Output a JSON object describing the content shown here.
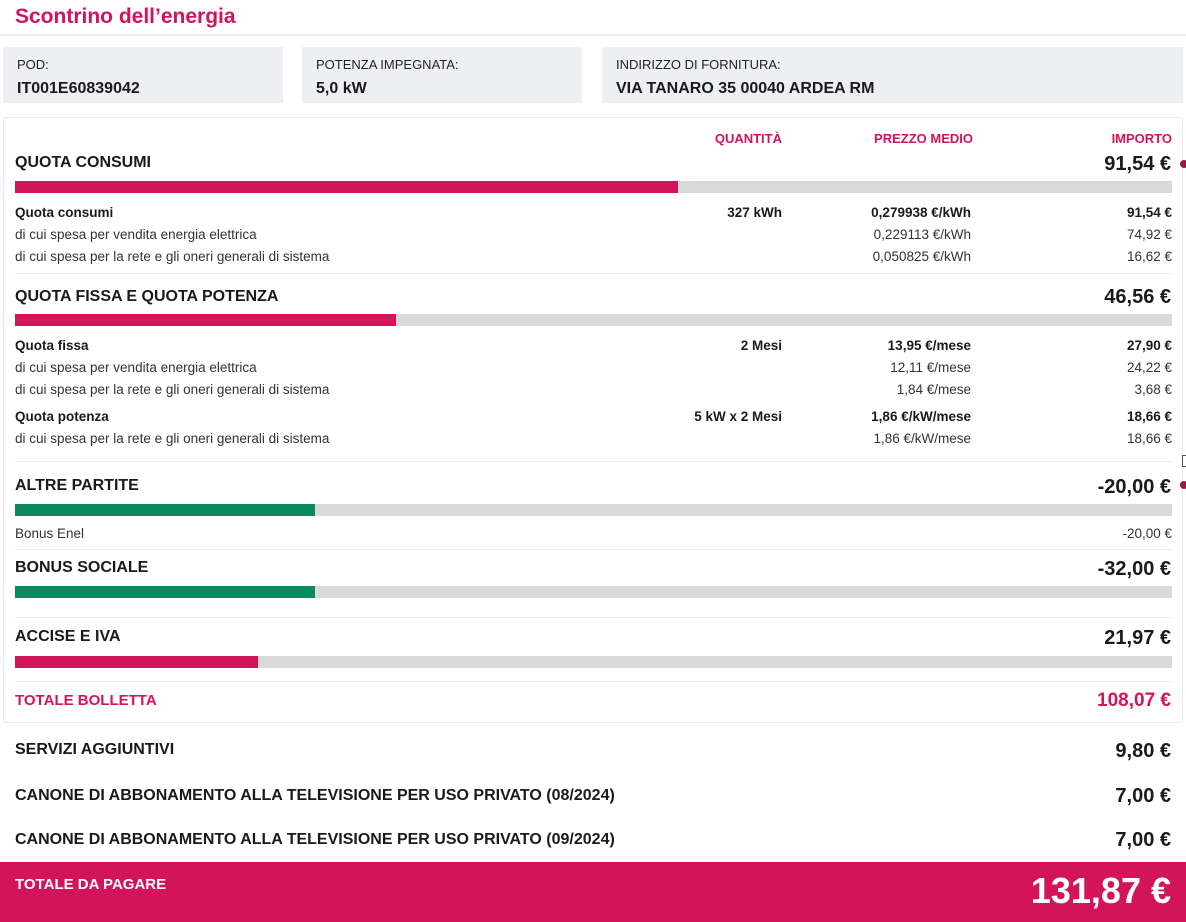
{
  "header": {
    "title": "Scontrino dell’energia"
  },
  "info": [
    {
      "label": "POD:",
      "value": "IT001E60839042"
    },
    {
      "label": "POTENZA IMPEGNATA:",
      "value": "5,0 kW"
    },
    {
      "label": "INDIRIZZO DI FORNITURA:",
      "value": "VIA TANARO 35 00040 ARDEA RM"
    }
  ],
  "columns": {
    "quantity": "QUANTITÀ",
    "price": "PREZZO MEDIO",
    "amount": "IMPORTO"
  },
  "colors": {
    "accent": "#d4145a",
    "green": "#0a8a5e",
    "bar_bg": "#d9d9d9"
  },
  "sections": [
    {
      "title": "QUOTA CONSUMI",
      "amount": "91,54 €",
      "bar_fraction": 0.573,
      "bar_color": "accent",
      "rows": [
        {
          "desc": "Quota consumi",
          "qty": "327 kWh",
          "price": "0,279938 €/kWh",
          "amount": "91,54 €",
          "bold": true
        },
        {
          "desc": "di cui spesa per vendita energia elettrica",
          "qty": "",
          "price": "0,229113 €/kWh",
          "amount": "74,92 €",
          "bold": false
        },
        {
          "desc": "di cui spesa per la rete e gli oneri generali di sistema",
          "qty": "",
          "price": "0,050825 €/kWh",
          "amount": "16,62 €",
          "bold": false
        }
      ]
    },
    {
      "title": "QUOTA FISSA E QUOTA POTENZA",
      "amount": "46,56 €",
      "bar_fraction": 0.329,
      "bar_color": "accent",
      "rows": [
        {
          "desc": "Quota fissa",
          "qty": "2 Mesi",
          "price": "13,95 €/mese",
          "amount": "27,90 €",
          "bold": true
        },
        {
          "desc": "di cui spesa per vendita energia elettrica",
          "qty": "",
          "price": "12,11 €/mese",
          "amount": "24,22 €",
          "bold": false
        },
        {
          "desc": "di cui spesa per la rete e gli oneri generali di sistema",
          "qty": "",
          "price": "1,84 €/mese",
          "amount": "3,68 €",
          "bold": false
        },
        {
          "desc": "Quota potenza",
          "qty": "5 kW x 2 Mesi",
          "price": "1,86 €/kW/mese",
          "amount": "18,66 €",
          "bold": true
        },
        {
          "desc": "di cui spesa per la rete e gli oneri generali di sistema",
          "qty": "",
          "price": "1,86 €/kW/mese",
          "amount": "18,66 €",
          "bold": false
        }
      ]
    },
    {
      "title": "ALTRE PARTITE",
      "amount": "-20,00 €",
      "bar_fraction": 0.259,
      "bar_color": "green",
      "rows": [
        {
          "desc": "Bonus Enel",
          "qty": "",
          "price": "",
          "amount": "-20,00 €",
          "bold": false
        }
      ]
    },
    {
      "title": "BONUS SOCIALE",
      "amount": "-32,00 €",
      "bar_fraction": 0.259,
      "bar_color": "green",
      "rows": []
    },
    {
      "title": "ACCISE E IVA",
      "amount": "21,97 €",
      "bar_fraction": 0.21,
      "bar_color": "accent",
      "rows": []
    }
  ],
  "total_bolletta": {
    "label": "TOTALE BOLLETTA",
    "amount": "108,07 €"
  },
  "extras": [
    {
      "label": "SERVIZI AGGIUNTIVI",
      "amount": "9,80 €"
    },
    {
      "label": "CANONE DI ABBONAMENTO ALLA TELEVISIONE PER USO PRIVATO (08/2024)",
      "amount": "7,00 €"
    },
    {
      "label": "CANONE DI ABBONAMENTO ALLA TELEVISIONE PER USO PRIVATO (09/2024)",
      "amount": "7,00 €"
    }
  ],
  "total_da_pagare": {
    "label": "TOTALE DA PAGARE",
    "amount": "131,87 €"
  }
}
